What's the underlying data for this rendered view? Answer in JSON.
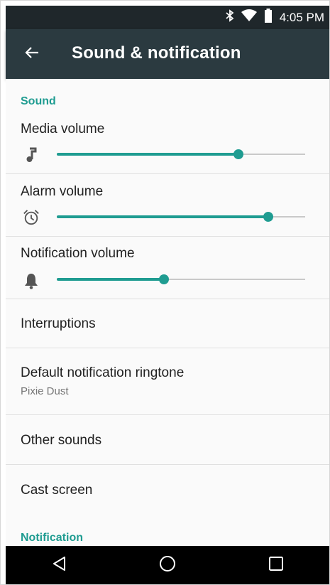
{
  "status_bar": {
    "time": "4:05 PM",
    "icons": [
      "bluetooth-icon",
      "wifi-icon",
      "battery-icon"
    ]
  },
  "app_bar": {
    "title": "Sound & notification",
    "back_icon": "arrow-back-icon"
  },
  "sound_section": {
    "header": "Sound",
    "media": {
      "label": "Media volume",
      "icon": "music-note-icon",
      "level": 0.73
    },
    "alarm": {
      "label": "Alarm volume",
      "icon": "alarm-clock-icon",
      "level": 0.85
    },
    "notification": {
      "label": "Notification volume",
      "icon": "bell-icon",
      "level": 0.43
    }
  },
  "items": {
    "interruptions": "Interruptions",
    "ringtone_title": "Default notification ringtone",
    "ringtone_value": "Pixie Dust",
    "other_sounds": "Other sounds",
    "cast_screen": "Cast screen"
  },
  "notification_section": {
    "header": "Notification"
  },
  "nav_bar": {
    "icons": [
      "back-triangle-icon",
      "home-circle-icon",
      "recents-square-icon"
    ]
  },
  "colors": {
    "accent": "#1f9c91",
    "app_bar": "#2b3a40",
    "status_bar": "#1f272b"
  }
}
